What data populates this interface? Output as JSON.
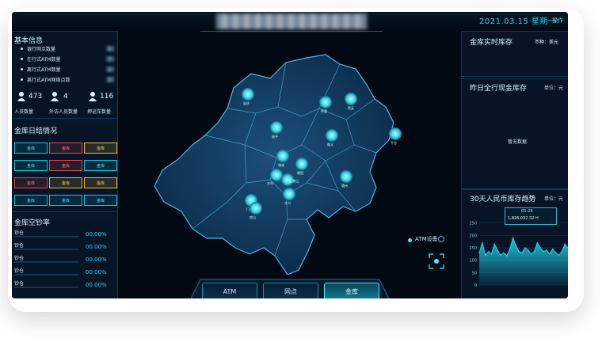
{
  "header": {
    "datetime": "2021.03.15 星期一",
    "nav_right": "操作"
  },
  "left_top": {
    "title": "基本信息",
    "items": [
      "银行网点数量",
      "在行式ATM数量",
      "离行式ATM数量",
      "离行式ATM网络点数"
    ],
    "stats": [
      {
        "value": "473",
        "label": "人员数量"
      },
      {
        "value": "4",
        "label": "外访人员数量"
      },
      {
        "value": "116",
        "label": "押运车数量"
      }
    ]
  },
  "left_mid": {
    "title": "金库日结情况",
    "boxes": [
      "金库",
      "金库",
      "金库",
      "金库",
      "金库",
      "金库",
      "金库",
      "金库",
      "金库",
      "金库",
      "金库",
      "金库"
    ]
  },
  "left_bot": {
    "title": "金库空钞率",
    "rows": [
      "钞仓",
      "钞仓",
      "钞仓",
      "钞仓",
      "钞仓"
    ],
    "pct": [
      "00.00%",
      "00.00%",
      "00.00%",
      "00.00%",
      "00.00%"
    ]
  },
  "right_top": {
    "title": "金库实时库存",
    "unit": "币种：美元"
  },
  "right_mid": {
    "title": "昨日全行现金库存",
    "unit": "单位：元",
    "empty": "暂无数据"
  },
  "right_bot": {
    "title": "30天人民币库存趋势",
    "unit": "单位：元",
    "tooltip_date": "05-29",
    "tooltip_value": "1,826,032.32 H"
  },
  "map": {
    "legend": "ATM设备",
    "pins": [
      "延庆",
      "怀柔",
      "密云",
      "平谷",
      "顺义",
      "昌平",
      "海淀",
      "朝阳",
      "通州",
      "大兴",
      "丰台",
      "石景山",
      "门头沟",
      "房山"
    ]
  },
  "tabs": [
    "ATM",
    "网点",
    "金库"
  ],
  "chart_data": {
    "type": "area",
    "title": "30天人民币库存趋势",
    "ylabel": "",
    "xlabel": "",
    "yticks": [
      "250",
      "200",
      "150",
      "100",
      "50",
      "0"
    ],
    "ylim": [
      0,
      300
    ],
    "values": [
      130,
      170,
      120,
      135,
      125,
      165,
      140,
      120,
      130,
      118,
      145,
      190,
      160,
      135,
      130,
      150,
      140,
      125,
      135,
      170,
      150,
      135,
      140,
      125,
      145,
      130,
      120,
      135,
      165,
      150
    ],
    "accent": "#22d3ee"
  }
}
